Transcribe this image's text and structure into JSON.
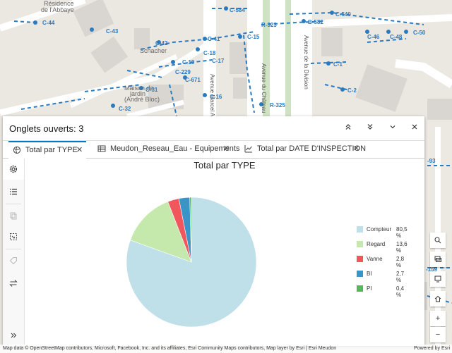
{
  "map": {
    "labels": [
      {
        "text": "Résidence",
        "kind": "plain"
      },
      {
        "text": "de l'Abbaye",
        "kind": "plain"
      },
      {
        "text": "C-44",
        "kind": "node"
      },
      {
        "text": "C-43",
        "kind": "node"
      },
      {
        "text": "C-584",
        "kind": "node"
      },
      {
        "text": "C-540",
        "kind": "node"
      },
      {
        "text": "B-582",
        "kind": "node"
      },
      {
        "text": "R-323",
        "kind": "node"
      },
      {
        "text": "C-50",
        "kind": "node"
      },
      {
        "text": "C-46",
        "kind": "node"
      },
      {
        "text": "C-48",
        "kind": "node"
      },
      {
        "text": "C-41",
        "kind": "node"
      },
      {
        "text": "C-42",
        "kind": "node"
      },
      {
        "text": "Schacher",
        "kind": "plain"
      },
      {
        "text": "C-18",
        "kind": "node"
      },
      {
        "text": "C-19",
        "kind": "node"
      },
      {
        "text": "C-17",
        "kind": "node"
      },
      {
        "text": "C-229",
        "kind": "node"
      },
      {
        "text": "C-671",
        "kind": "node"
      },
      {
        "text": "Maison de",
        "kind": "plain"
      },
      {
        "text": "jardin",
        "kind": "plain"
      },
      {
        "text": "(André Bloc)",
        "kind": "plain"
      },
      {
        "text": "C-31",
        "kind": "node"
      },
      {
        "text": "C-16",
        "kind": "node"
      },
      {
        "text": "C-32",
        "kind": "node"
      },
      {
        "text": "C-15",
        "kind": "node"
      },
      {
        "text": "C-1",
        "kind": "node"
      },
      {
        "text": "C-2",
        "kind": "node"
      },
      {
        "text": "R-325",
        "kind": "node"
      },
      {
        "text": "Avenue Marcel Allégot",
        "kind": "road"
      },
      {
        "text": "Avenue du Château",
        "kind": "road"
      },
      {
        "text": "Avenue de la Division",
        "kind": "road"
      },
      {
        "text": "-93",
        "kind": "node"
      },
      {
        "text": "-159",
        "kind": "node"
      }
    ]
  },
  "panel": {
    "title": "Onglets ouverts: 3",
    "tabs": [
      {
        "label": "Total par TYPE",
        "icon": "globe-icon",
        "active": true
      },
      {
        "label": "Meudon_Reseau_Eau - Equipements",
        "icon": "table-icon",
        "active": false
      },
      {
        "label": "Total par DATE D'INSPECTION",
        "icon": "chart-icon",
        "active": false
      }
    ],
    "header_buttons": [
      "chevrons-up-icon",
      "chevrons-down-icon",
      "chevron-down-icon",
      "close-icon"
    ],
    "sidebar_icons": [
      "gear-icon",
      "list-icon",
      "copy-icon",
      "selection-icon",
      "tag-icon",
      "swap-icon",
      "expand-icon"
    ]
  },
  "chart_data": {
    "type": "pie",
    "title": "Total par TYPE",
    "series": [
      {
        "name": "Compteur",
        "pct_label": "80,5 %",
        "value": 80.5,
        "color": "#bfdfe9"
      },
      {
        "name": "Regard",
        "pct_label": "13,6 %",
        "value": 13.6,
        "color": "#c5e8ad"
      },
      {
        "name": "Vanne",
        "pct_label": "2,8 %",
        "value": 2.8,
        "color": "#f1565d"
      },
      {
        "name": "BI",
        "pct_label": "2,7 %",
        "value": 2.7,
        "color": "#3a94c6"
      },
      {
        "name": "PI",
        "pct_label": "0,4 %",
        "value": 0.4,
        "color": "#52b85a"
      }
    ],
    "legend_position": "right"
  },
  "map_controls": [
    "search-icon",
    "layers-icon",
    "monitor-icon",
    "home-icon",
    "zoom-in-icon",
    "zoom-out-icon"
  ],
  "attribution": {
    "text": "Map data © OpenStreetMap contributors, Microsoft, Facebook, Inc. and its affiliates, Esri Community Maps contributors, Map layer by Esri | Esri Meudon",
    "powered": "Powered by Esri"
  }
}
